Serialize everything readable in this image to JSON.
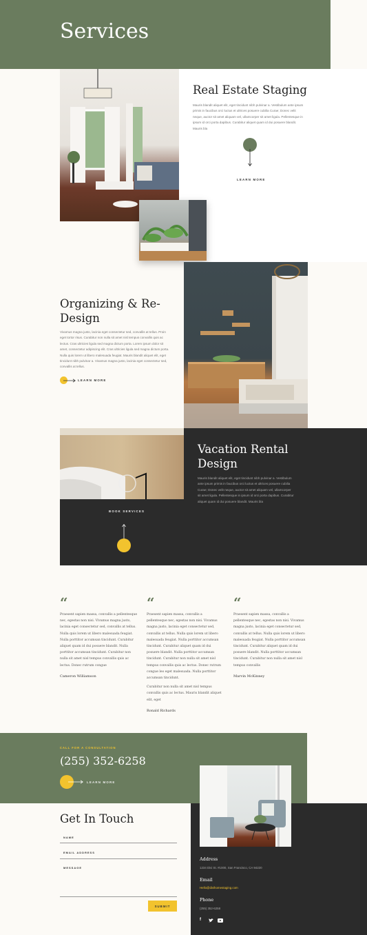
{
  "header": {
    "title": "Services"
  },
  "services": [
    {
      "title": "Real Estate Staging",
      "text": "Mauris blandit aliquet elit, eget tincidunt nibh pulvinar a. Vestibulum ante ipsum primis in faucibus orci luctus et ultrices posuere cubilia Curae; Donec velit neque, auctor sit amet aliquam vel, ullamcorper sit amet ligula. Pellentesque in ipsum id orci porta dapibus. Curabitur aliquet quam id dui posuere blandit. Mauris bla",
      "link": "LEARN MORE"
    },
    {
      "title": "Organizing & Re-Design",
      "text": "Vivamus magna justo, lacinia eget consectetur sed, convallis at tellus. Proin eget tortor risus. Curabitur non nulla sit amet nisl tempus convallis quis ac lectus. Cras ultricies ligula sed magna dictum porta. Lorem ipsum dolor sit amet, consectetur adipiscing elit. Cras ultricies ligula sed magna dictum porta. Nulla quis lorem ut libero malesuada feugiat. Mauris blandit aliquet elit, eget tincidunt nibh pulvinar a. Vivamus magna justo, lacinia eget consectetur sed, convallis at tellus.",
      "link": "LEARN MORE"
    },
    {
      "title": "Vacation Rental Design",
      "text": "Mauris blandit aliquet elit, eget tincidunt nibh pulvinar a. Vestibulum ante ipsum primis in faucibus orci luctus et ultrices posuere cubilia Curae; Donec velit neque, auctor sit amet aliquam vel, ullamcorper sit amet ligula. Pellentesque in ipsum id orci porta dapibus. Curabitur aliquet quam id dui posuere blandit. Mauris bla",
      "link": "BOOK SERVICES"
    }
  ],
  "testimonials": [
    {
      "text": "Praesent sapien massa, convallis a pellentesque nec, egestas non nisi. Vivamus magna justo, lacinia eget consectetur sed, convallis at tellus. Nulla quis lorem ut libero malesuada feugiat. Nulla porttitor accumsan tincidunt. Curabitur aliquet quam id dui posuere blandit. Nulla porttitor accumsan tincidunt. Curabitur non nulla sit amet nisl tempus convallis quis ac lectus. Donec rutrum congue",
      "text2": "",
      "name": "Cameron Williamson"
    },
    {
      "text": "Praesent sapien massa, convallis a pellentesque nec, egestas non nisi. Vivamus magna justo, lacinia eget consectetur sed, convallis at tellus. Nulla quis lorem ut libero malesuada feugiat. Nulla porttitor accumsan tincidunt. Curabitur aliquet quam id dui posuere blandit. Nulla porttitor accumsan tincidunt. Curabitur non nulla sit amet nisl tempus convallis quis ac lectus. Donec rutrum congue leo eget malesuada. Nulla porttitor accumsan tincidunt.",
      "text2": "Curabitur non nulla sit amet nisl tempus convallis quis ac lectus. Mauris blandit aliquet elit, eget",
      "name": "Ronald Richards"
    },
    {
      "text": "Praesent sapien massa, convallis a pellentesque nec, egestas non nisi. Vivamus magna justo, lacinia eget consectetur sed, convallis at tellus. Nulla quis lorem ut libero malesuada feugiat. Nulla porttitor accumsan tincidunt. Curabitur aliquet quam id dui posuere blandit. Nulla porttitor accumsan tincidunt. Curabitur non nulla sit amet nisl tempus convallis",
      "text2": "",
      "name": "Marvin McKinney"
    }
  ],
  "consult": {
    "eyebrow": "CALL FOR A CONSULTATION",
    "phone": "(255) 352-6258",
    "link": "LEARN MORE"
  },
  "contact": {
    "title": "Get In Touch",
    "fields": {
      "name": "NAME",
      "email": "EMAIL ADDRESS",
      "message": "MESSAGE"
    },
    "submit": "SUBMIT",
    "address_label": "Address",
    "address": "1234 Divi St. #1000, San Francisco, CA 94220",
    "email_label": "Email",
    "email": "Hello@divihomestaging.com",
    "phone_label": "Phone",
    "phone": "(255) 352-6258",
    "social": [
      "facebook-icon",
      "twitter-icon",
      "youtube-icon"
    ]
  },
  "colors": {
    "green": "#6a7c5e",
    "dark": "#2b2b2b",
    "accent": "#f2c32e",
    "cream": "#fcfaf6"
  }
}
